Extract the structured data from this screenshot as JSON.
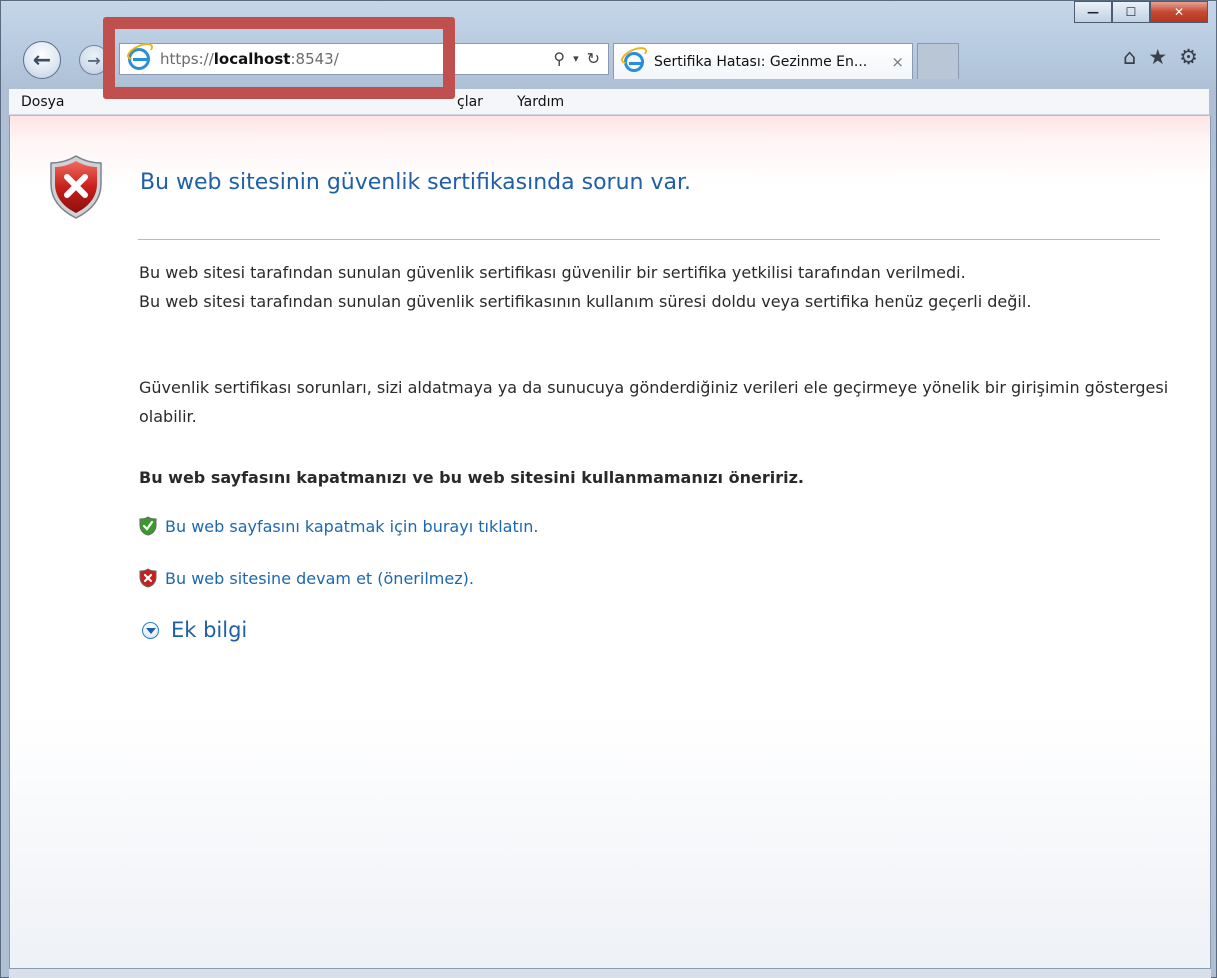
{
  "browser": {
    "url_prefix": "https://",
    "url_host": "localhost",
    "url_suffix": ":8543/",
    "tab_title": "Sertifika Hatası: Gezinme En...",
    "tab_close": "×"
  },
  "window_controls": {
    "minimize": "—",
    "maximize": "☐",
    "close": "✕"
  },
  "menu": {
    "dosya": "Dosya",
    "araclar": "çlar",
    "yardim": "Yardım"
  },
  "page": {
    "heading": "Bu web sitesinin güvenlik sertifikasında sorun var.",
    "paragraph1_line1": "Bu web sitesi tarafından sunulan güvenlik sertifikası güvenilir bir sertifika yetkilisi tarafından verilmedi.",
    "paragraph1_line2": "Bu web sitesi tarafından sunulan güvenlik sertifikasının kullanım süresi doldu veya sertifika henüz geçerli değil.",
    "paragraph2": "Güvenlik sertifikası sorunları, sizi aldatmaya ya da sunucuya gönderdiğiniz verileri ele geçirmeye yönelik bir girişimin göstergesi olabilir.",
    "recommendation": "Bu web sayfasını kapatmanızı ve bu web sitesini kullanmamanızı öneririz.",
    "close_link": "Bu web sayfasını kapatmak için burayı tıklatın.",
    "continue_link": "Bu web sitesine devam et (önerilmez).",
    "more_info": "Ek bilgi"
  },
  "colors": {
    "heading": "#1f5fa8",
    "link": "#1c68b0",
    "annotation": "#c0504d",
    "shield_red": "#c8201c",
    "shield_green": "#3a9a2c"
  }
}
